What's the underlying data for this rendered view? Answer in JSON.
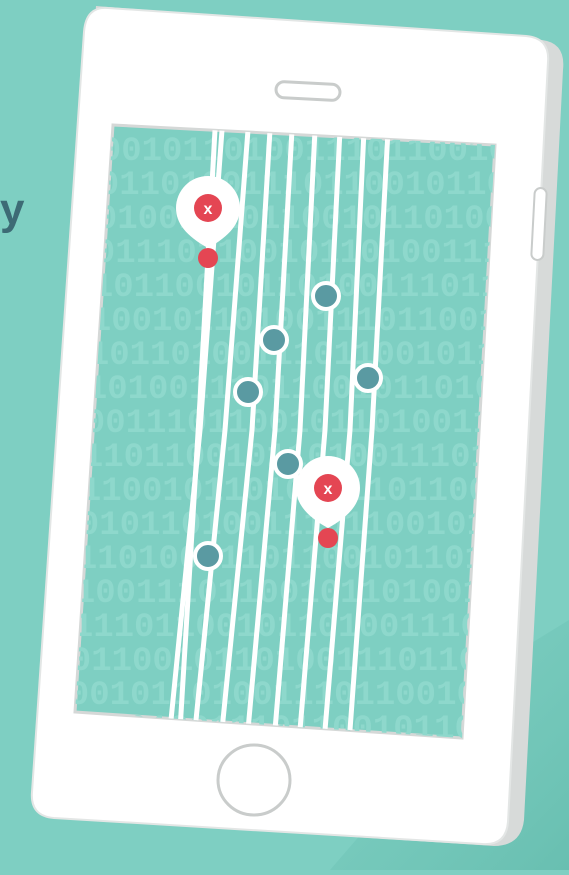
{
  "colors": {
    "background": "#7ecfc2",
    "screen": "#7ecfc2",
    "phone_body": "#ffffff",
    "phone_side": "#d7dad9",
    "lines": "#ffffff",
    "dot": "#5a9aa2",
    "pin_red": "#e44653",
    "text_partial": "#3d6b75"
  },
  "partial_text": "y",
  "binary_pattern": "1100101101001110",
  "icons": {
    "pin_top": "close-icon",
    "pin_bottom": "close-icon",
    "home_button": "home-button-icon",
    "speaker": "speaker-slot-icon",
    "side_button": "side-button-icon"
  },
  "pin_glyph": "x"
}
